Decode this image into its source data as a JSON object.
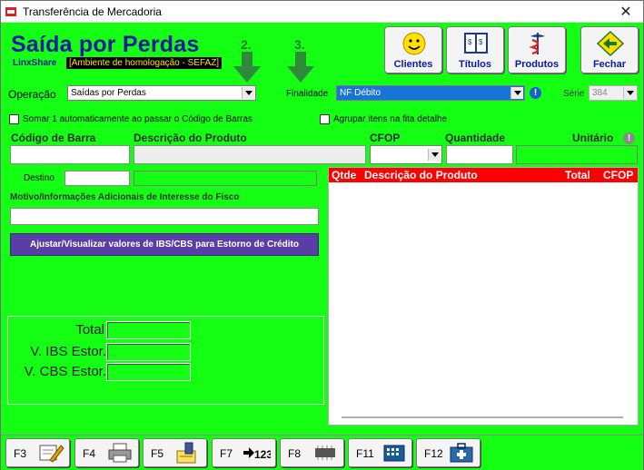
{
  "window": {
    "title": "Transferência de Mercadoria",
    "close_glyph": "✕"
  },
  "header": {
    "title": "Saída por Perdas",
    "brand": "LinxShare",
    "environment": "[Ambiente de homologação - SEFAZ]",
    "step2": "2.",
    "step3": "3."
  },
  "toolbar": {
    "clientes": "Clientes",
    "titulos": "Títulos",
    "produtos": "Produtos",
    "fechar": "Fechar"
  },
  "form": {
    "operacao_label": "Operação",
    "operacao_value": "Saídas por Perdas",
    "finalidade_label": "Finalidade",
    "finalidade_value": "NF Débito",
    "serie_label": "Série",
    "serie_value": "384",
    "somar_label": "Somar 1 automaticamente ao passar o Código de Barras",
    "agrupar_label": "Agrupar itens na fita detalhe",
    "col_codigo": "Código de Barra",
    "col_descricao": "Descrição do Produto",
    "col_cfop": "CFOP",
    "col_quantidade": "Quantidade",
    "col_unitario": "Unitário",
    "destino_label": "Destino",
    "motivo_label": "Motivo/Informações Adicionais de Interesse do Fisco",
    "ibs_button": "Ajustar/Visualizar valores de IBS/CBS para Estorno de Crédito"
  },
  "grid": {
    "columns": [
      "Qtde",
      "Descrição do Produto",
      "Total",
      "CFOP"
    ]
  },
  "totals": {
    "total_label": "Total",
    "ibs_label": "V. IBS Estor.",
    "cbs_label": "V. CBS Estor."
  },
  "fkeys": {
    "f3": "F3",
    "f4": "F4",
    "f5": "F5",
    "f7": "F7",
    "f8": "F8",
    "f11": "F11",
    "f12": "F12"
  },
  "colors": {
    "background": "#14ff14",
    "title_blue": "#0a1a9e",
    "grid_header": "#ff0000",
    "purple_button": "#5a3ea6",
    "selection": "#1874d8"
  }
}
